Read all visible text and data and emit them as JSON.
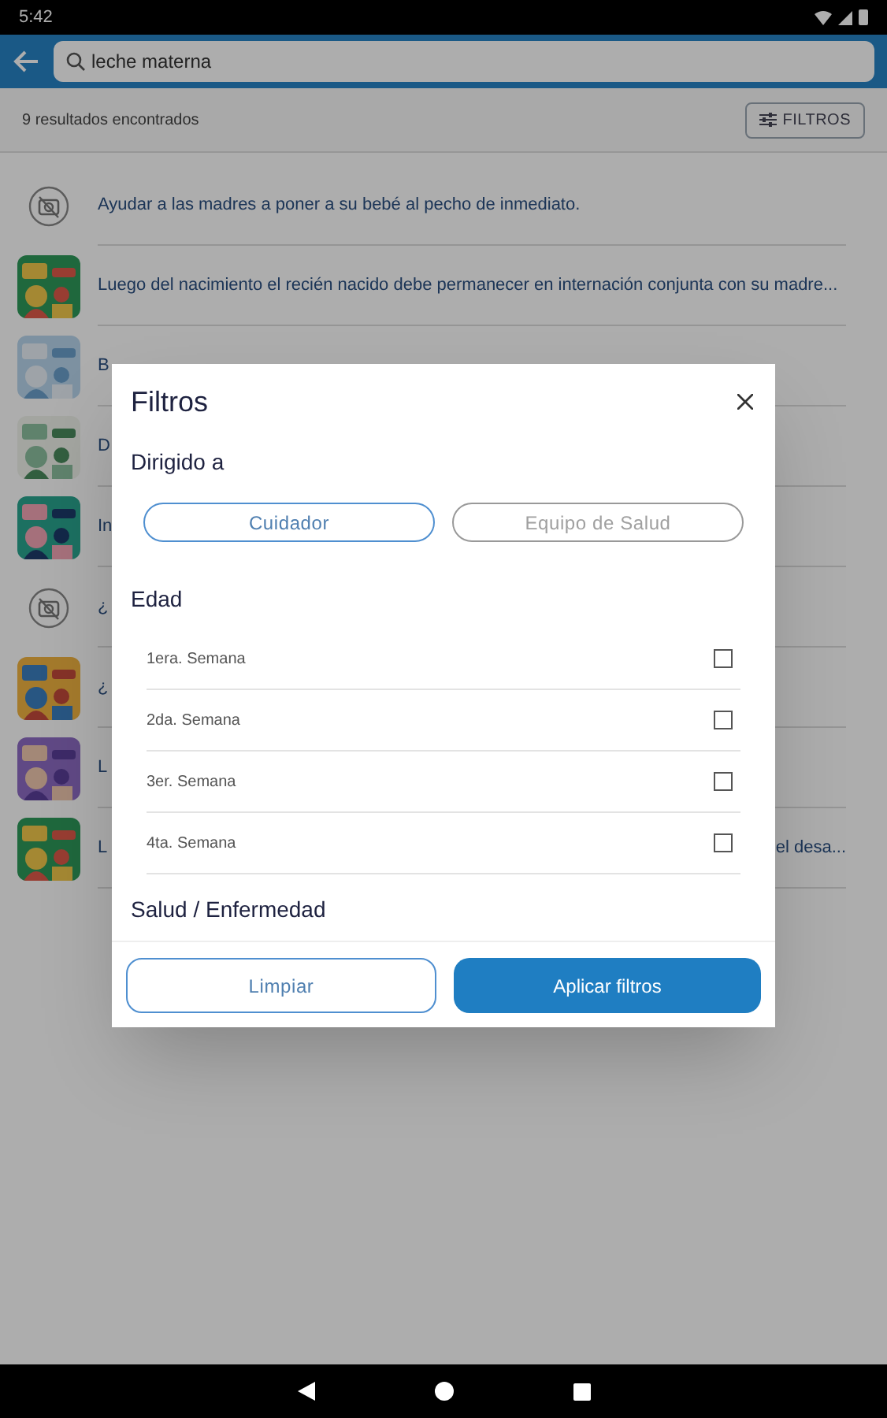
{
  "status_bar": {
    "time": "5:42"
  },
  "search": {
    "value": "leche materna"
  },
  "results": {
    "count": "9 resultados encontrados",
    "filter_button": "FILTROS"
  },
  "list": [
    {
      "kind": "placeholder",
      "text": "Ayudar a las madres a poner a su bebé al pecho de inmediato."
    },
    {
      "kind": "picture",
      "text": "Luego del nacimiento el recién nacido debe permanecer en internación conjunta con su madre..."
    },
    {
      "kind": "picture",
      "text": "B"
    },
    {
      "kind": "picture",
      "text": "D"
    },
    {
      "kind": "picture",
      "text": "In"
    },
    {
      "kind": "placeholder",
      "text": "¿"
    },
    {
      "kind": "picture",
      "text": "¿"
    },
    {
      "kind": "picture",
      "text": "L"
    },
    {
      "kind": "picture",
      "text": "L",
      "text_end": "el desa..."
    }
  ],
  "dialog": {
    "title": "Filtros",
    "sections": [
      {
        "title": "Dirigido a",
        "kind": "chips",
        "options": [
          {
            "label": "Cuidador",
            "selected": true
          },
          {
            "label": "Equipo de Salud",
            "selected": false
          }
        ]
      },
      {
        "title": "Edad",
        "kind": "checkboxes",
        "options": [
          {
            "label": "1era. Semana",
            "checked": false
          },
          {
            "label": "2da. Semana",
            "checked": false
          },
          {
            "label": "3er. Semana",
            "checked": false
          },
          {
            "label": "4ta. Semana",
            "checked": false
          }
        ]
      },
      {
        "title": "Salud / Enfermedad",
        "kind": "heading"
      }
    ],
    "buttons": [
      {
        "label": "Limpiar",
        "kind": "outline"
      },
      {
        "label": "Aplicar filtros",
        "kind": "primary"
      }
    ]
  }
}
